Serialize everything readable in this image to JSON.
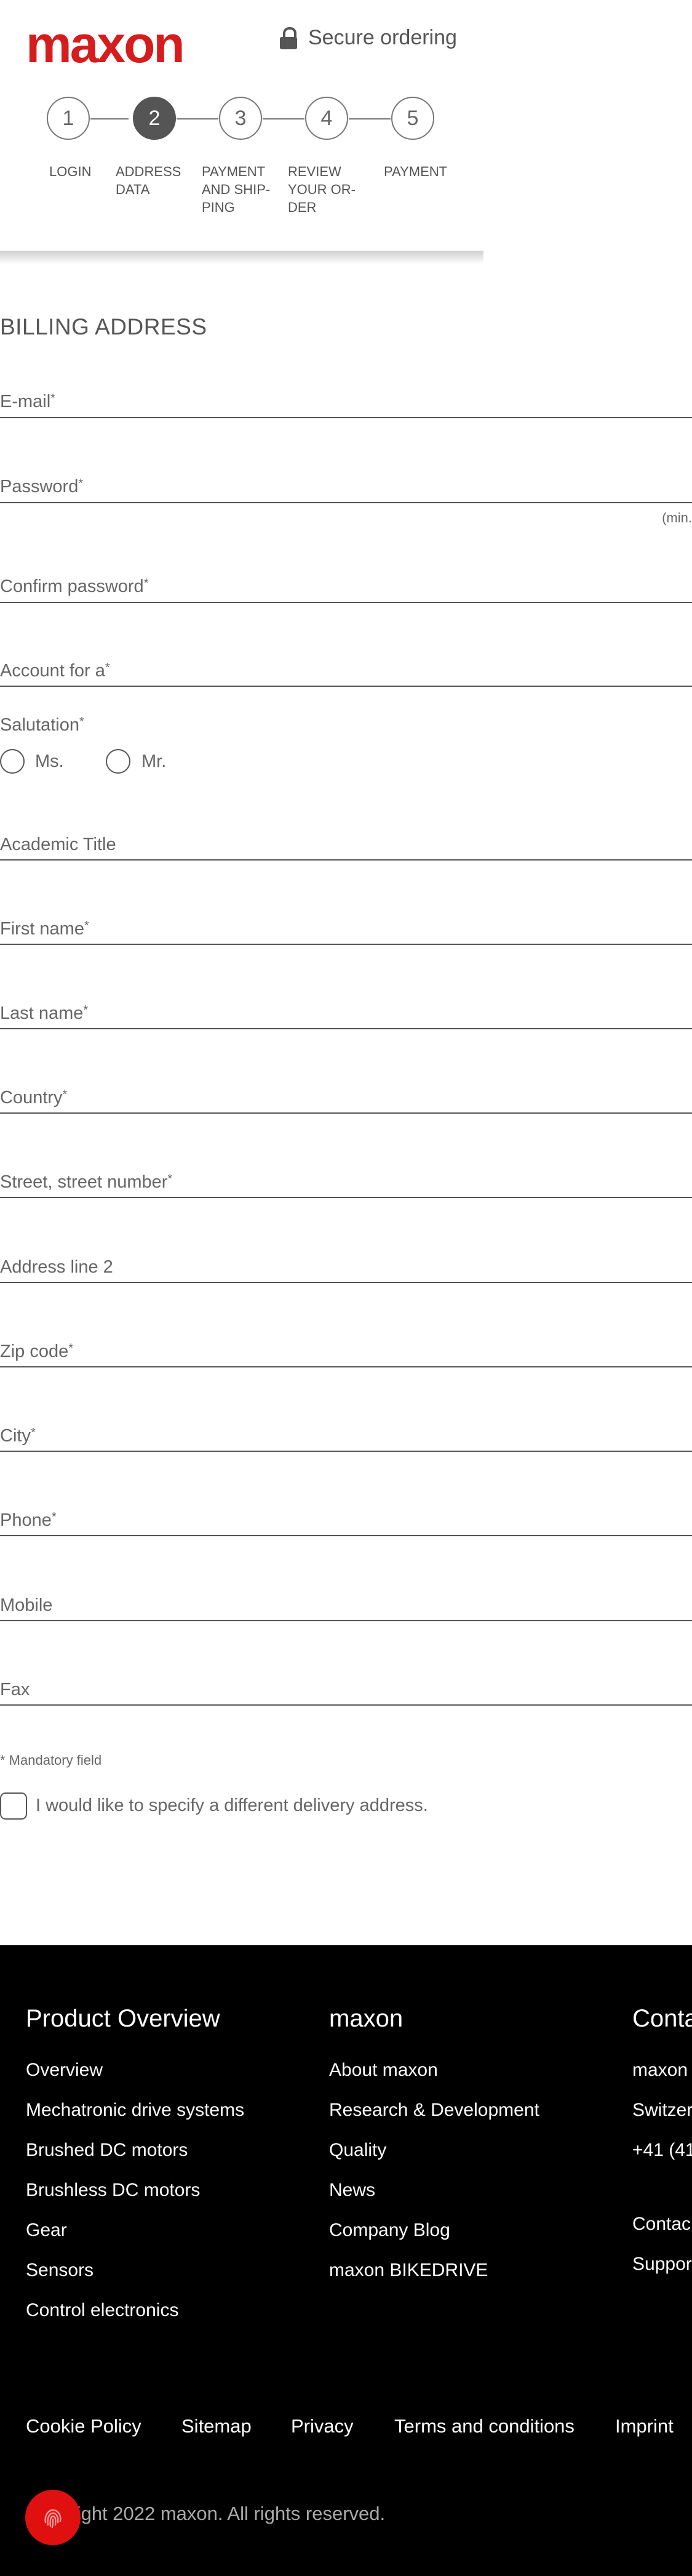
{
  "header": {
    "logo": "maxon",
    "secure_label": "Secure ordering",
    "steps": [
      {
        "num": "1",
        "label": "LOGIN",
        "active": false
      },
      {
        "num": "2",
        "label": "ADDRESS DATA",
        "active": true
      },
      {
        "num": "3",
        "label": "PAYMENT AND SHIP-PING",
        "active": false
      },
      {
        "num": "4",
        "label": "REVIEW YOUR OR-DER",
        "active": false
      },
      {
        "num": "5",
        "label": "PAYMENT",
        "active": false
      }
    ]
  },
  "form": {
    "title": "BILLING ADDRESS",
    "password_hint": "(min.",
    "salutation": {
      "label": "Salutation",
      "options": [
        "Ms.",
        "Mr."
      ]
    },
    "fields": {
      "email": "E-mail",
      "password": "Password",
      "confirm_password": "Confirm password",
      "account_for": "Account for a",
      "academic_title": "Academic Title",
      "first_name": "First name",
      "last_name": "Last name",
      "country": "Country",
      "street": "Street, street number",
      "address2": "Address line 2",
      "zip": "Zip code",
      "city": "City",
      "phone": "Phone",
      "mobile": "Mobile",
      "fax": "Fax"
    },
    "required_mark": "*",
    "mandatory_note": "* Mandatory field",
    "delivery_checkbox": "I would like to specify a different delivery address."
  },
  "footer": {
    "col1": {
      "heading": "Product Overview",
      "links": [
        "Overview",
        "Mechatronic drive systems",
        "Brushed DC motors",
        "Brushless DC motors",
        "Gear",
        "Sensors",
        "Control electronics"
      ]
    },
    "col2": {
      "heading": "maxon",
      "links": [
        "About maxon",
        "Research & Development",
        "Quality",
        "News",
        "Company Blog",
        "maxon BIKEDRIVE"
      ]
    },
    "col3": {
      "heading": "Conta",
      "lines": [
        "maxon",
        "Switzer",
        "+41 (41",
        "Contac",
        "Suppor"
      ]
    },
    "bottom_links": [
      "Cookie Policy",
      "Sitemap",
      "Privacy",
      "Terms and conditions",
      "Imprint"
    ],
    "copyright": "Copyright 2022 maxon. All rights reserved."
  },
  "colors": {
    "brand_red": "#d61d1d",
    "footer_bg": "#000000",
    "active_step": "#555555"
  },
  "icons": {
    "lock": "lock-icon",
    "fab": "fingerprint-icon"
  }
}
